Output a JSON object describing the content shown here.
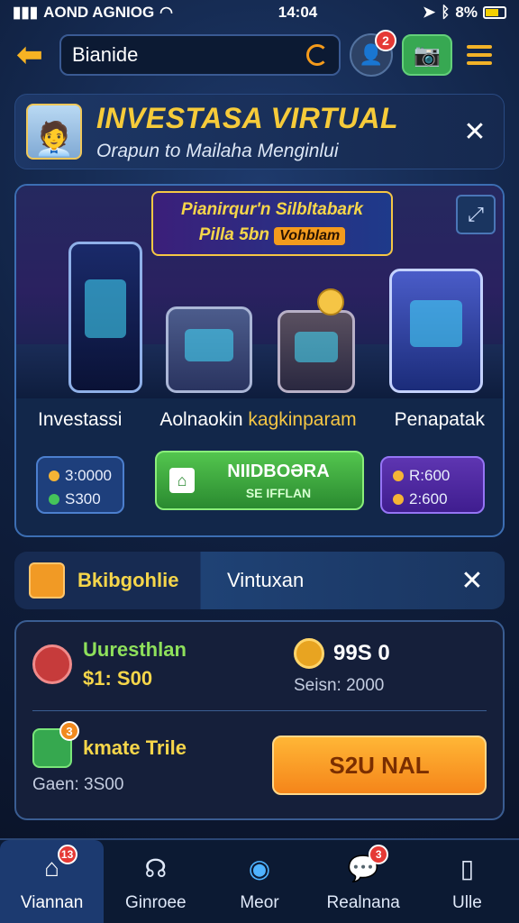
{
  "status_bar": {
    "carrier": "AOND AGNIOG",
    "time": "14:04",
    "battery": "8%"
  },
  "topbar": {
    "search_value": "Bianide",
    "user_badge": "2"
  },
  "hero": {
    "title": "INVESTASA VIRTUAL",
    "subtitle": "Orapun to Mailaha Menginlui"
  },
  "banner": {
    "promo_line1": "Pianirqur'n Silbltabark",
    "promo_line2": "Pilla 5bn",
    "promo_chip": "Vohblam",
    "labels": [
      "Investassi",
      "Aolnaokin",
      "kagkinparam",
      "Penapatak"
    ],
    "stat_left": {
      "line1": "3:0000",
      "line2": "S300"
    },
    "cta": {
      "title": "NIIDBOƏRA",
      "subtitle": "SE IFFLAN"
    },
    "stat_right": {
      "line1": "R:600",
      "line2": "2:600"
    }
  },
  "subheader": {
    "left": "Bkibgohlie",
    "right": "Vintuxan"
  },
  "panel": {
    "row1": {
      "title": "Uuresthlan",
      "amount": "$1: S00",
      "value": "99S 0",
      "note": "Seisn: 2000"
    },
    "row2": {
      "badge": "3",
      "title": "kmate Trile",
      "note": "Gaen: 3S00",
      "button": "S2U NAL"
    }
  },
  "nav": [
    {
      "label": "Viannan",
      "icon": "home-icon",
      "badge": "13"
    },
    {
      "label": "Ginroee",
      "icon": "headset-icon",
      "badge": ""
    },
    {
      "label": "Meor",
      "icon": "orb-icon",
      "badge": ""
    },
    {
      "label": "Realnana",
      "icon": "chat-icon",
      "badge": "3"
    },
    {
      "label": "Ulle",
      "icon": "door-icon",
      "badge": ""
    }
  ],
  "colors": {
    "accent_yellow": "#f6c744",
    "accent_green": "#53c54e",
    "accent_orange": "#f5851a",
    "bg_dark": "#0f1f3e"
  }
}
